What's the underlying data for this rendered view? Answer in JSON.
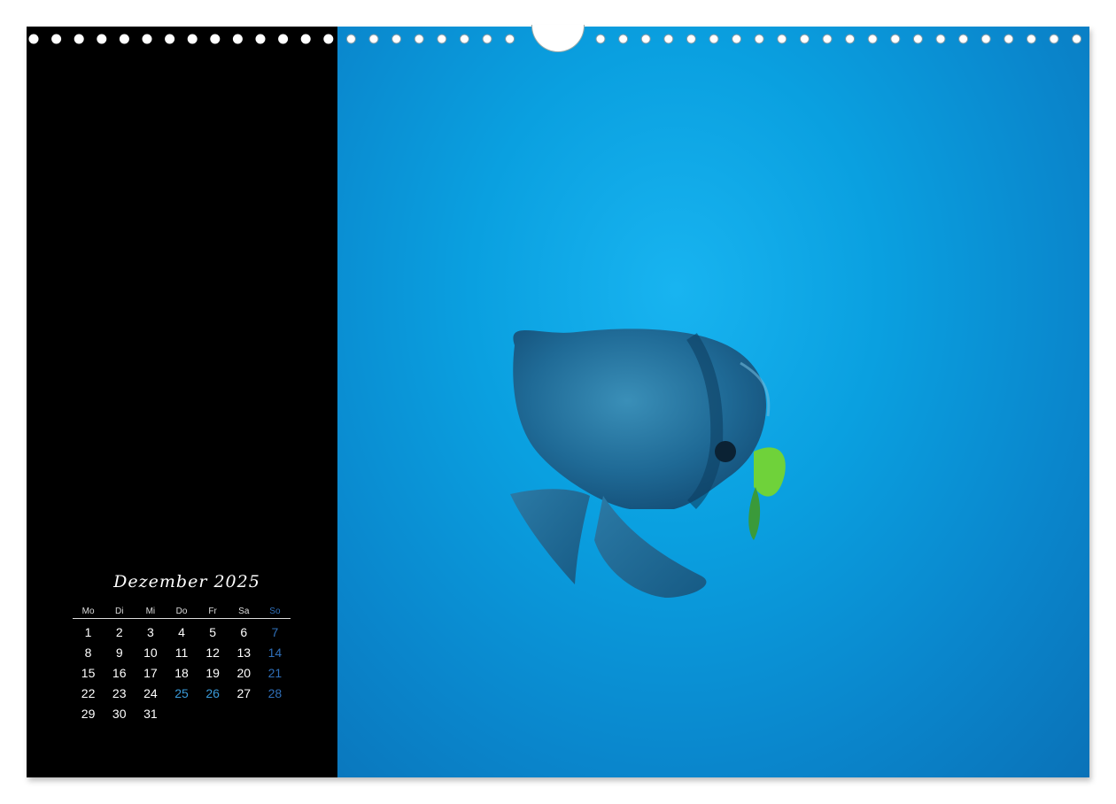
{
  "calendar": {
    "month_title": "Dezember 2025",
    "weekdays": [
      "Mo",
      "Di",
      "Mi",
      "Do",
      "Fr",
      "Sa",
      "So"
    ],
    "weeks": [
      [
        "1",
        "2",
        "3",
        "4",
        "5",
        "6",
        "7"
      ],
      [
        "8",
        "9",
        "10",
        "11",
        "12",
        "13",
        "14"
      ],
      [
        "15",
        "16",
        "17",
        "18",
        "19",
        "20",
        "21"
      ],
      [
        "22",
        "23",
        "24",
        "25",
        "26",
        "27",
        "28"
      ],
      [
        "29",
        "30",
        "31",
        "",
        "",
        "",
        ""
      ]
    ],
    "holidays": [
      "25",
      "26"
    ]
  },
  "colors": {
    "left_panel": "#000000",
    "water": "#0a96d8",
    "sunday": "#2f6fb8",
    "holiday": "#3a9ad8"
  },
  "photo": {
    "subject": "batfish-photo"
  }
}
